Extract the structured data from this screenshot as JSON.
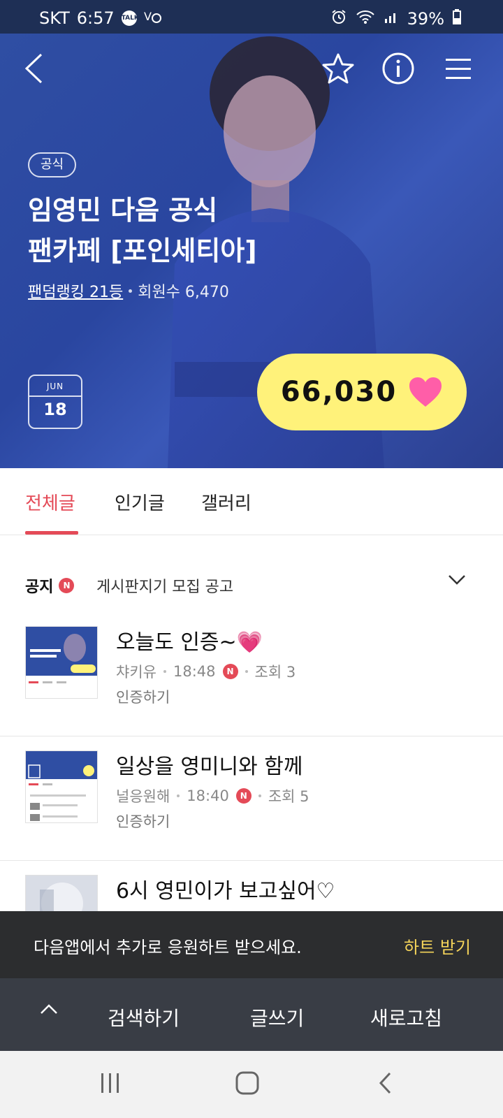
{
  "status_bar": {
    "carrier": "SKT",
    "time": "6:57",
    "talk_icon": "TALK",
    "battery": "39%"
  },
  "hero": {
    "chip": "공식",
    "title_line1": "임영민 다음 공식",
    "title_line2": "팬카페 [포인세티아]",
    "ranking": "팬덤랭킹 21등",
    "members": "회원수 6,470",
    "date_month": "JUN",
    "date_day": "18",
    "heart_count": "66,030",
    "heart_color": "#ff5ea8",
    "accent_yellow": "#fff27a"
  },
  "tabs": [
    {
      "label": "전체글",
      "active": true
    },
    {
      "label": "인기글",
      "active": false
    },
    {
      "label": "갤러리",
      "active": false
    }
  ],
  "notice": {
    "label": "공지",
    "badge": "N",
    "text": "게시판지기 모집 공고"
  },
  "posts": [
    {
      "title": "오늘도 인증~💗",
      "author": "챠키유",
      "time": "18:48",
      "badge": "N",
      "views": "조회 3",
      "tag": "인증하기"
    },
    {
      "title": "일상을 영미니와 함께",
      "author": "널응원해",
      "time": "18:40",
      "badge": "N",
      "views": "조회 5",
      "tag": "인증하기"
    },
    {
      "title": "6시 영민이가 보고싶어♡",
      "author": "",
      "time": "",
      "badge": "",
      "views": "",
      "tag": ""
    }
  ],
  "promo": {
    "message": "다음앱에서 추가로 응원하트 받으세요.",
    "cta": "하트 받기"
  },
  "toolbar": {
    "search": "검색하기",
    "write": "글쓰기",
    "refresh": "새로고침"
  },
  "colors": {
    "accent_red": "#e44a57",
    "hero_blue": "#2f4ea3",
    "promo_bg": "#2c2d2f",
    "toolbar_bg": "#393d45"
  }
}
